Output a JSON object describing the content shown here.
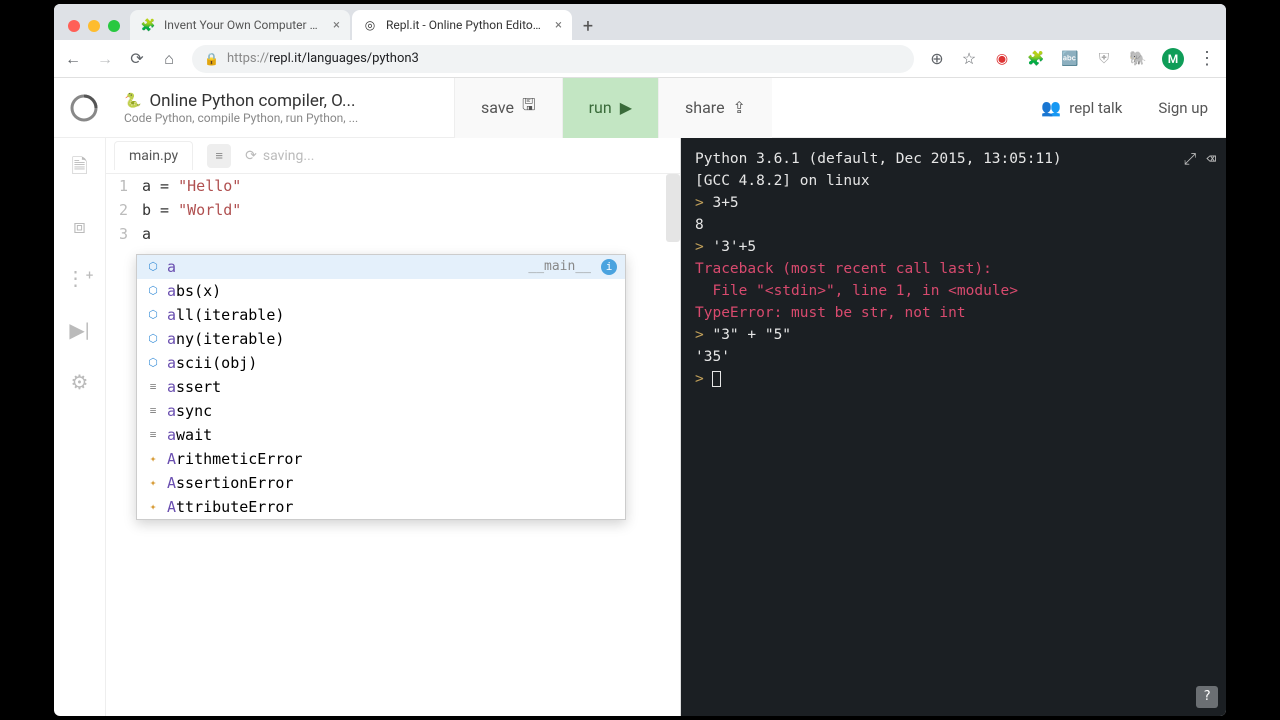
{
  "browser": {
    "tabs": [
      {
        "title": "Invent Your Own Computer Ga",
        "favicon": "🧩",
        "active": false
      },
      {
        "title": "Repl.it - Online Python Editor a",
        "favicon": "◎",
        "active": true
      }
    ],
    "url_proto": "https://",
    "url_rest": "repl.it/languages/python3",
    "avatar_letter": "M"
  },
  "header": {
    "title": "Online Python compiler, O...",
    "subtitle": "Code Python, compile Python, run Python, ...",
    "save": "save",
    "run": "run",
    "share": "share",
    "repl_talk": "repl talk",
    "sign_up": "Sign up"
  },
  "editor": {
    "filename": "main.py",
    "status": "saving...",
    "lines": [
      {
        "n": "1",
        "pre": "a = ",
        "str": "\"Hello\""
      },
      {
        "n": "2",
        "pre": "b = ",
        "str": "\"World\""
      },
      {
        "n": "3",
        "pre": "a",
        "str": ""
      }
    ]
  },
  "autocomplete": {
    "hint": "__main__",
    "items": [
      {
        "icon": "var",
        "match": "a",
        "rest": ""
      },
      {
        "icon": "var",
        "match": "a",
        "rest": "bs(x)"
      },
      {
        "icon": "var",
        "match": "a",
        "rest": "ll(iterable)"
      },
      {
        "icon": "var",
        "match": "a",
        "rest": "ny(iterable)"
      },
      {
        "icon": "var",
        "match": "a",
        "rest": "scii(obj)"
      },
      {
        "icon": "kw",
        "match": "a",
        "rest": "ssert"
      },
      {
        "icon": "kw",
        "match": "a",
        "rest": "sync"
      },
      {
        "icon": "kw",
        "match": "a",
        "rest": "wait"
      },
      {
        "icon": "cls",
        "match": "A",
        "rest": "rithmeticError"
      },
      {
        "icon": "cls",
        "match": "A",
        "rest": "ssertionError"
      },
      {
        "icon": "cls",
        "match": "A",
        "rest": "ttributeError"
      }
    ]
  },
  "terminal": {
    "banner1": "Python 3.6.1 (default, Dec 2015, 13:05:11)",
    "banner2": "[GCC 4.8.2] on linux",
    "l1_in": "3+5",
    "l1_out": "8",
    "l2_in": "'3'+5",
    "err1": "Traceback (most recent call last):",
    "err2": "  File \"<stdin>\", line 1, in <module>",
    "err3": "TypeError: must be str, not int",
    "l3_in": "\"3\" + \"5\"",
    "l3_out": "'35'"
  },
  "help": "?"
}
